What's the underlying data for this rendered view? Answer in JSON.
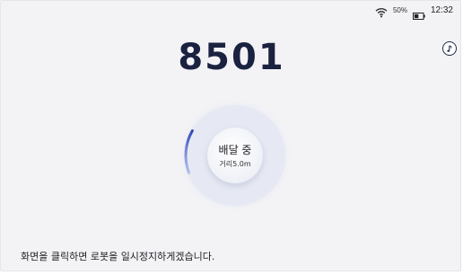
{
  "status_bar": {
    "battery_percent": "50%",
    "time": "12:32"
  },
  "order": {
    "number": "8501"
  },
  "delivery": {
    "status": "배달 중",
    "distance": "거리5.0m",
    "progress": 0.14,
    "accent_color": "#4a63c7"
  },
  "hint": {
    "text": "화면을 클릭하면 로봇을 일시정지하게겠습니다."
  },
  "icons": {
    "status": [
      "wifi-icon",
      "battery-icon"
    ],
    "music": "music-note-icon"
  }
}
